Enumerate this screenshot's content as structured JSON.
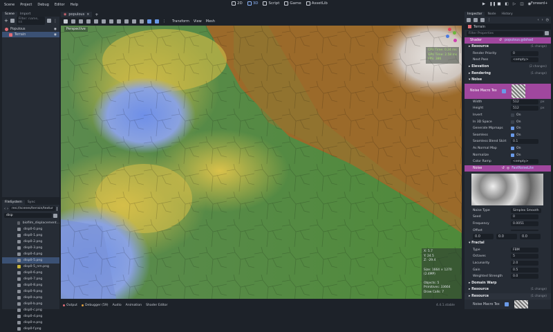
{
  "menu": [
    "Scene",
    "Project",
    "Debug",
    "Editor",
    "Help"
  ],
  "modes": [
    {
      "label": "2D",
      "active": false
    },
    {
      "label": "3D",
      "active": true
    },
    {
      "label": "Script",
      "active": false
    },
    {
      "label": "Game",
      "active": false
    },
    {
      "label": "AssetLib",
      "active": false
    }
  ],
  "renderer": "Forward+",
  "scene_tabs": {
    "scene": "Scene",
    "import": "Import"
  },
  "scene_filter_placeholder": "Filter: name, t:t",
  "scene_tree": [
    {
      "name": "Populous",
      "selected": false
    },
    {
      "name": "Terrain",
      "selected": true
    }
  ],
  "filesystem_tabs": {
    "filesystem": "FileSystem",
    "history": "Sync"
  },
  "fs_path": "res://scenes/terrain/textur",
  "fs_search": "disp",
  "files": [
    {
      "name": "biofilm_displacement...",
      "type": "d"
    },
    {
      "name": "disp0-0.png",
      "type": "g"
    },
    {
      "name": "disp0-1.png",
      "type": "g"
    },
    {
      "name": "disp0-2.png",
      "type": "g"
    },
    {
      "name": "disp0-3.png",
      "type": "g"
    },
    {
      "name": "disp0-4.png",
      "type": "g"
    },
    {
      "name": "disp0-5.png",
      "type": "g",
      "selected": true
    },
    {
      "name": "disp0-5_nm.png",
      "type": "y"
    },
    {
      "name": "disp0-6.png",
      "type": "g"
    },
    {
      "name": "disp0-7.png",
      "type": "g"
    },
    {
      "name": "disp0-8.png",
      "type": "g"
    },
    {
      "name": "disp0-9.png",
      "type": "g"
    },
    {
      "name": "disp0-a.png",
      "type": "g"
    },
    {
      "name": "disp0-b.png",
      "type": "g"
    },
    {
      "name": "disp0-c.png",
      "type": "g"
    },
    {
      "name": "disp0-d.png",
      "type": "g"
    },
    {
      "name": "disp0-e.png",
      "type": "g"
    },
    {
      "name": "disp0-f.png",
      "type": "g"
    }
  ],
  "editor_tab": "populous",
  "viewport": {
    "menus": [
      "Transform",
      "View",
      "Mesh"
    ],
    "perspective_label": "Perspective",
    "timing": [
      "CPU Time: 0.24 ms",
      "GPU Time: 2.58 ms",
      "FPS: 386"
    ],
    "coords": [
      "X: 5.7",
      "Y: 24.5",
      "Z: -29.4"
    ],
    "size": "Size: 1664 × 1270 (2.4MP)",
    "objects": [
      "Objects: 5",
      "Primitives: 33664",
      "Draw Calls: 7"
    ]
  },
  "bottom_tabs": [
    "Output",
    "Debugger (59)",
    "Audio",
    "Animation",
    "Shader Editor"
  ],
  "version": "4.4.1.stable",
  "inspector": {
    "tabs": [
      "Inspector",
      "Node",
      "History"
    ],
    "node": "Terrain",
    "filter_placeholder": "Filter Properties",
    "shader_label": "Shader",
    "shader_value": "populous.gdshad",
    "rows": [
      {
        "kind": "section",
        "label": "Resource",
        "count": "(1 change)"
      },
      {
        "kind": "prop",
        "label": "Render Priority",
        "value": "0"
      },
      {
        "kind": "prop",
        "label": "Next Pass",
        "value": "<empty>"
      },
      {
        "kind": "section",
        "label": "Elevation",
        "count": "(2 changes)"
      },
      {
        "kind": "section",
        "label": "Rendering",
        "count": "(1 change)"
      },
      {
        "kind": "section",
        "label": "Noise",
        "count": ""
      }
    ],
    "noise_macro": "Noise Macro Tex",
    "props": [
      {
        "label": "Width",
        "value": "512",
        "unit": "px"
      },
      {
        "label": "Height",
        "value": "512",
        "unit": "px"
      },
      {
        "label": "Invert",
        "value": "On",
        "check": false
      },
      {
        "label": "In 3D Space",
        "value": "On",
        "check": false
      },
      {
        "label": "Generate Mipmaps",
        "value": "On",
        "check": true
      },
      {
        "label": "Seamless",
        "value": "On",
        "check": true
      },
      {
        "label": "Seamless Blend Skirt",
        "value": "0.1"
      },
      {
        "label": "As Normal Map",
        "value": "On",
        "check": true
      },
      {
        "label": "Normalize",
        "value": "On",
        "check": true
      },
      {
        "label": "Color Ramp",
        "value": "<empty>"
      }
    ],
    "noise_label": "Noise",
    "noise_value": "FastNoiseLite",
    "noise_props": [
      {
        "label": "Noise Type",
        "value": "Simplex Smooth"
      },
      {
        "label": "Seed",
        "value": "0"
      },
      {
        "label": "Frequency",
        "value": "0.0051"
      },
      {
        "label": "Offset",
        "value": ""
      }
    ],
    "offset": [
      "0.0",
      "0.0",
      "0.0"
    ],
    "fractal_label": "Fractal",
    "fractal_props": [
      {
        "label": "Type",
        "value": "FBM"
      },
      {
        "label": "Octaves",
        "value": "5"
      },
      {
        "label": "Lacunarity",
        "value": "2.0"
      },
      {
        "label": "Gain",
        "value": "0.5"
      },
      {
        "label": "Weighted Strength",
        "value": "0.0"
      }
    ],
    "domain_warp": "Domain Warp",
    "resource1": "Resource",
    "resource1_count": "(1 change)",
    "resource2": "Resource",
    "resource2_count": "(1 change)",
    "noise_macro2": "Noise Macro Tex"
  },
  "colors": {
    "accent": "#8fb8ff",
    "selection": "#3b5174",
    "panel": "#262c35",
    "bg": "#1d2229",
    "magenta": "#a0479e"
  }
}
